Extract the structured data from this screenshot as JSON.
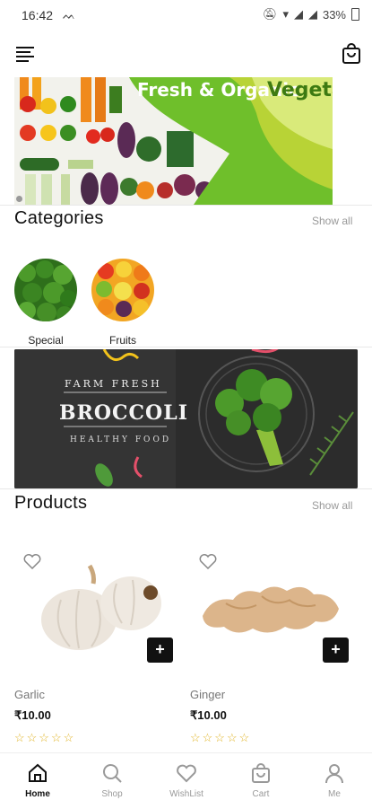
{
  "status_bar": {
    "time": "16:42",
    "battery": "33%"
  },
  "hero": {
    "title_white": "Fresh & Organic",
    "title_green": "Vegetables"
  },
  "categories": {
    "title": "Categories",
    "show_all": "Show all",
    "items": [
      {
        "label": "Special"
      },
      {
        "label": "Fruits"
      }
    ]
  },
  "promo_banner": {
    "line1": "FARM FRESH",
    "line2": "BROCCOLI",
    "line3": "HEALTHY FOOD"
  },
  "products": {
    "title": "Products",
    "show_all": "Show all",
    "items": [
      {
        "name": "Garlic",
        "price": "₹10.00",
        "stars": "☆☆☆☆☆",
        "add_label": "+"
      },
      {
        "name": "Ginger",
        "price": "₹10.00",
        "stars": "☆☆☆☆☆",
        "add_label": "+"
      }
    ]
  },
  "bottom_nav": {
    "items": [
      {
        "label": "Home",
        "icon": "home-icon",
        "active": true
      },
      {
        "label": "Shop",
        "icon": "search-icon",
        "active": false
      },
      {
        "label": "WishList",
        "icon": "heart-icon",
        "active": false
      },
      {
        "label": "Cart",
        "icon": "cart-icon",
        "active": false
      },
      {
        "label": "Me",
        "icon": "user-icon",
        "active": false
      }
    ]
  },
  "colors": {
    "brand_green": "#3d7a12",
    "lime": "#b8d336",
    "star": "#e0b323"
  }
}
